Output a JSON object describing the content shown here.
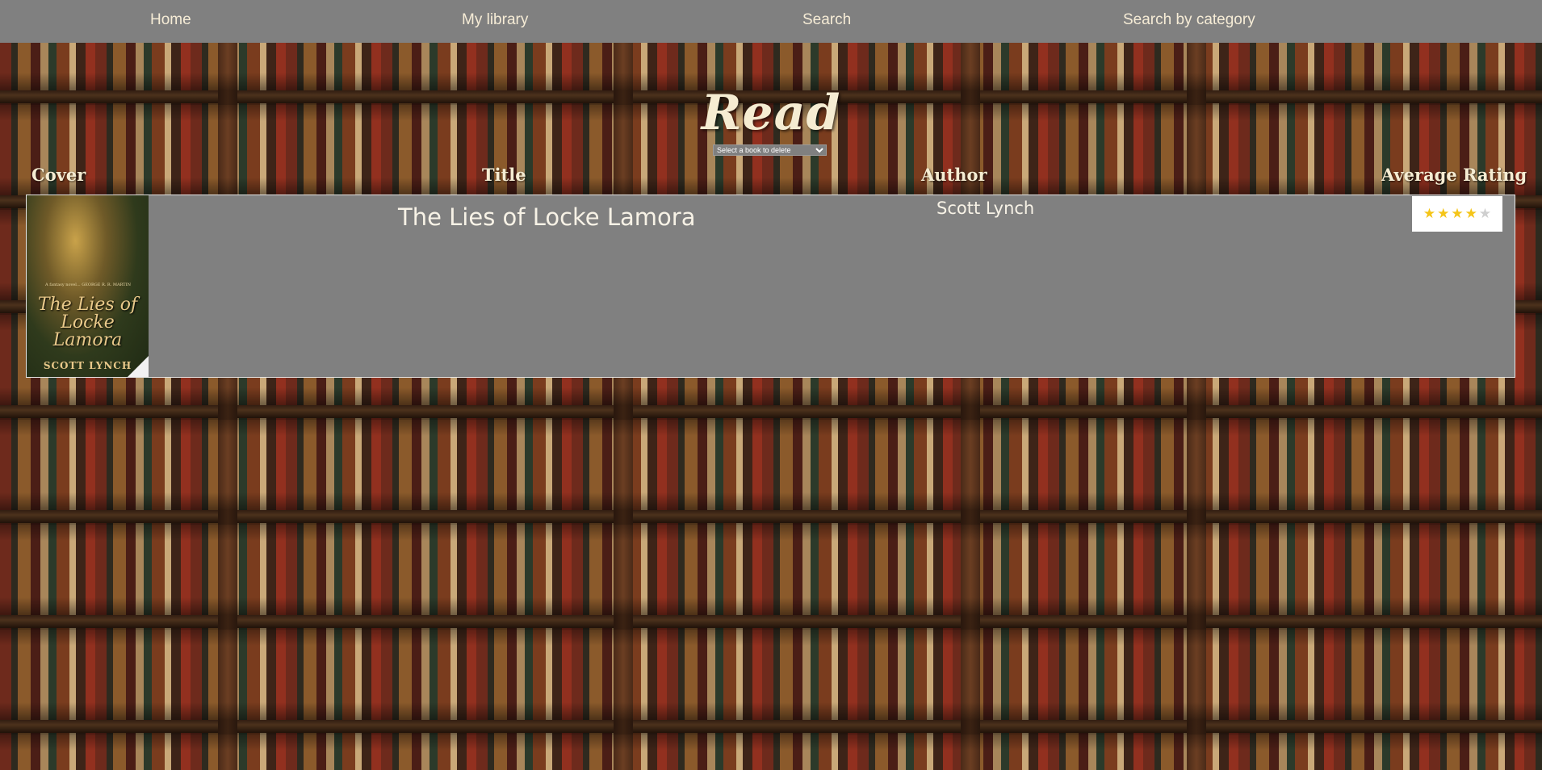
{
  "nav": {
    "home": "Home",
    "my_library": "My library",
    "search": "Search",
    "search_by_category": "Search by category"
  },
  "page": {
    "title": "Read",
    "delete_select_placeholder": "Select a book to delete"
  },
  "table": {
    "headers": {
      "cover": "Cover",
      "title": "Title",
      "author": "Author",
      "average_rating": "Average Rating"
    },
    "rows": [
      {
        "title": "The Lies of Locke Lamora",
        "author": "Scott Lynch",
        "rating": 4,
        "rating_max": 5,
        "cover": {
          "quote": "A fantasy novel...  GEORGE R. R. MARTIN",
          "title": "The Lies of Locke Lamora",
          "author": "SCOTT LYNCH"
        }
      }
    ]
  },
  "colors": {
    "nav_bg": "#808080",
    "nav_text": "#f6ecd6",
    "row_bg": "#808080",
    "star_filled": "#f5c518",
    "star_empty": "#cfcfcf"
  },
  "icons": {
    "star": "★"
  }
}
